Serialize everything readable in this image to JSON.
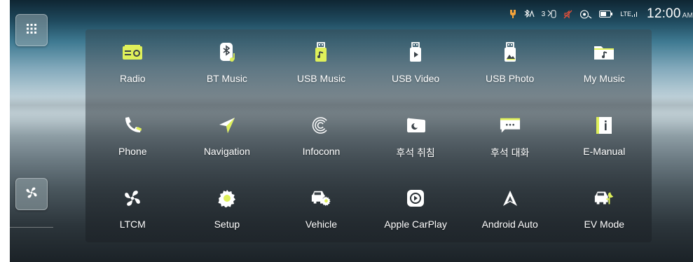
{
  "colors": {
    "accent": "#dff05a",
    "icon_white": "#ffffff",
    "status_warning": "#f2a23a",
    "status_alert": "#e8503a"
  },
  "status_bar": {
    "bt_battery_text": "3",
    "network_text": "LTE",
    "clock": "12:00",
    "ampm": "AM",
    "icons": [
      "charging-icon",
      "bluetooth-audio-icon",
      "phone-battery-icon",
      "mute-icon",
      "wifi-phone-icon",
      "battery-icon",
      "lte-signal-icon"
    ]
  },
  "sidebar": {
    "top_button_icon": "apps-grid-icon",
    "bottom_button_icon": "fan-icon"
  },
  "apps": [
    {
      "label": "Radio",
      "icon": "radio-icon"
    },
    {
      "label": "BT Music",
      "icon": "bt-music-icon"
    },
    {
      "label": "USB Music",
      "icon": "usb-music-icon"
    },
    {
      "label": "USB Video",
      "icon": "usb-video-icon"
    },
    {
      "label": "USB Photo",
      "icon": "usb-photo-icon"
    },
    {
      "label": "My Music",
      "icon": "folder-music-icon"
    },
    {
      "label": "Phone",
      "icon": "phone-icon"
    },
    {
      "label": "Navigation",
      "icon": "navigation-icon"
    },
    {
      "label": "Infoconn",
      "icon": "infoconn-icon"
    },
    {
      "label": "후석 취침",
      "icon": "rear-sleep-icon"
    },
    {
      "label": "후석 대화",
      "icon": "rear-talk-icon"
    },
    {
      "label": "E-Manual",
      "icon": "e-manual-icon"
    },
    {
      "label": "LTCM",
      "icon": "ltcm-fan-icon"
    },
    {
      "label": "Setup",
      "icon": "setup-gear-icon"
    },
    {
      "label": "Vehicle",
      "icon": "vehicle-icon"
    },
    {
      "label": "Apple CarPlay",
      "icon": "apple-carplay-icon"
    },
    {
      "label": "Android Auto",
      "icon": "android-auto-icon"
    },
    {
      "label": "EV Mode",
      "icon": "ev-mode-icon"
    }
  ]
}
